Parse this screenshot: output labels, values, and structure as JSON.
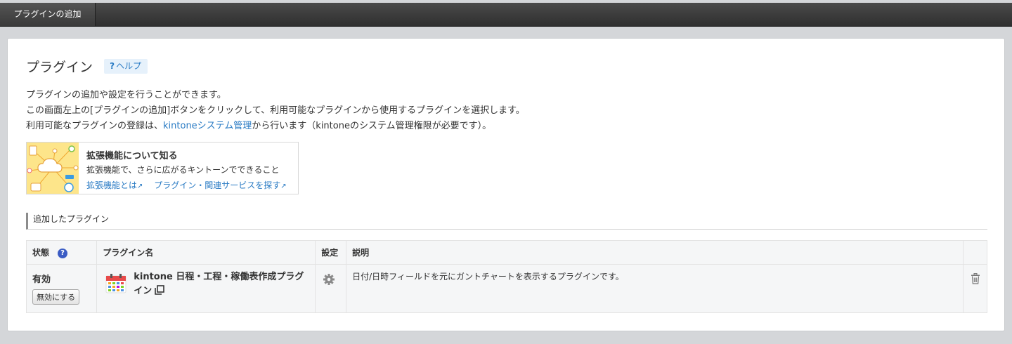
{
  "toolbar": {
    "add_plugin_button": "プラグインの追加"
  },
  "header": {
    "title": "プラグイン",
    "help_label": "ヘルプ"
  },
  "description": {
    "line1": "プラグインの追加や設定を行うことができます。",
    "line2": "この画面左上の[プラグインの追加]ボタンをクリックして、利用可能なプラグインから使用するプラグインを選択します。",
    "line3_before": "利用可能なプラグインの登録は、",
    "line3_link": "kintoneシステム管理",
    "line3_after": "から行います（kintoneのシステム管理権限が必要です）。"
  },
  "promo": {
    "title": "拡張機能について知る",
    "subtitle": "拡張機能で、さらに広がるキントーンでできること",
    "link1": "拡張機能とは",
    "link2": "プラグイン・関連サービスを探す"
  },
  "section": {
    "title": "追加したプラグイン"
  },
  "table": {
    "headers": {
      "status": "状態",
      "name": "プラグイン名",
      "settings": "設定",
      "description": "説明"
    },
    "rows": [
      {
        "status": "有効",
        "disable_label": "無効にする",
        "name": "kintone 日程・工程・稼働表作成プラグイン",
        "description": "日付/日時フィールドを元にガントチャートを表示するプラグインです。"
      }
    ]
  },
  "colors": {
    "link": "#2a7bc4",
    "topbar": "#3a3a3a",
    "help_bg": "#e6f1fb"
  }
}
